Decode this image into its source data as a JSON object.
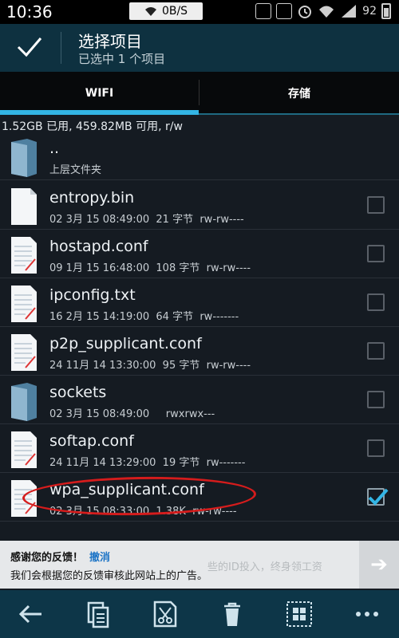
{
  "status_bar": {
    "time": "10:36",
    "network_speed": "0B/S",
    "battery_level": "92"
  },
  "action_bar": {
    "title": "选择项目",
    "subtitle": "已选中 1 个项目"
  },
  "tabs": [
    {
      "label": "WIFI",
      "selected": true
    },
    {
      "label": "存储",
      "selected": false
    }
  ],
  "storage_info": "1.52GB 已用, 459.82MB 可用, r/w",
  "files": [
    {
      "name": "..",
      "meta": "上层文件夹",
      "icon": "folder-icon",
      "checkbox": false,
      "checked": false
    },
    {
      "name": "entropy.bin",
      "meta": "02 3月 15 08:49:00  21 字节  rw-rw----",
      "icon": "file-icon",
      "checkbox": true,
      "checked": false
    },
    {
      "name": "hostapd.conf",
      "meta": "09 1月 15 16:48:00  108 字节  rw-rw----",
      "icon": "text-file-icon",
      "checkbox": true,
      "checked": false
    },
    {
      "name": "ipconfig.txt",
      "meta": "16 2月 15 14:19:00  64 字节  rw-------",
      "icon": "text-file-icon",
      "checkbox": true,
      "checked": false
    },
    {
      "name": "p2p_supplicant.conf",
      "meta": "24 11月 14 13:30:00  95 字节  rw-rw----",
      "icon": "text-file-icon",
      "checkbox": true,
      "checked": false
    },
    {
      "name": "sockets",
      "meta": "02 3月 15 08:49:00     rwxrwx---",
      "icon": "folder-icon",
      "checkbox": true,
      "checked": false
    },
    {
      "name": "softap.conf",
      "meta": "24 11月 14 13:29:00  19 字节  rw-------",
      "icon": "text-file-icon",
      "checkbox": true,
      "checked": false
    },
    {
      "name": "wpa_supplicant.conf",
      "meta": "02 3月 15 08:33:00  1.38K  rw-rw----",
      "icon": "text-file-icon",
      "checkbox": true,
      "checked": true
    }
  ],
  "ad_banner": {
    "feedback_text": "感谢您的反馈！",
    "undo_label": "撤消",
    "review_text": "我们会根据您的反馈审核此网站上的广告。",
    "ghost_text": "些的ID投入，终身领工资"
  },
  "colors": {
    "accent": "#33b5e5",
    "action_bar": "#0e3140",
    "toolbar": "#0d3648",
    "highlight_ellipse": "#d51c1c"
  },
  "toolbar": {
    "icons": [
      "back-arrow-icon",
      "copy-icon",
      "cut-icon",
      "delete-icon",
      "select-all-icon",
      "more-icon"
    ]
  }
}
